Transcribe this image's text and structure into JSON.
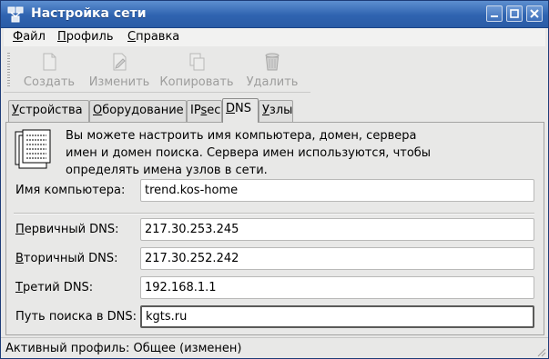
{
  "window": {
    "title": "Настройка сети",
    "controls": [
      "minimize",
      "maximize",
      "close"
    ]
  },
  "menubar": {
    "items": [
      {
        "mnemonic": "Ф",
        "rest": "айл"
      },
      {
        "mnemonic": "П",
        "rest": "рофиль"
      },
      {
        "mnemonic": "С",
        "rest": "правка"
      }
    ]
  },
  "toolbar": {
    "buttons": [
      {
        "label": "Создать",
        "icon": "new-document-icon",
        "enabled": false
      },
      {
        "label": "Изменить",
        "icon": "edit-document-icon",
        "enabled": false
      },
      {
        "label": "Копировать",
        "icon": "copy-icon",
        "enabled": false
      },
      {
        "label": "Удалить",
        "icon": "trash-icon",
        "enabled": false
      }
    ]
  },
  "tabs": [
    {
      "mnemonic": "У",
      "rest": "стройства",
      "active": false
    },
    {
      "mnemonic": "О",
      "rest": "борудование",
      "active": false
    },
    {
      "pre": "IP",
      "mnemonic": "s",
      "rest": "ec",
      "active": false
    },
    {
      "mnemonic": "D",
      "rest": "NS",
      "active": true
    },
    {
      "mnemonic": "У",
      "rest": "злы",
      "active": false
    }
  ],
  "dns": {
    "description": [
      "Вы можете настроить имя компьютера, домен, сервера",
      "имен и домен поиска. Сервера имен используются, чтобы",
      "определять имена узлов в сети."
    ],
    "hostname": {
      "label": "Имя компьютера:",
      "value": "trend.kos-home"
    },
    "primary": {
      "mnemonic": "П",
      "rest": "ервичный DNS:",
      "value": "217.30.253.245"
    },
    "secondary": {
      "mnemonic": "В",
      "rest": "торичный DNS:",
      "value": "217.30.252.242"
    },
    "tertiary": {
      "mnemonic": "Т",
      "rest": "ретий DNS:",
      "value": "192.168.1.1"
    },
    "search": {
      "label": "Путь поиска в DNS:",
      "value": "kgts.ru"
    }
  },
  "statusbar": {
    "text": "Активный профиль: Общее (изменен)"
  },
  "colors": {
    "titlebar": "#2f63b0",
    "window_bg": "#e8e8e7",
    "disabled_text": "#9d9d9c"
  }
}
